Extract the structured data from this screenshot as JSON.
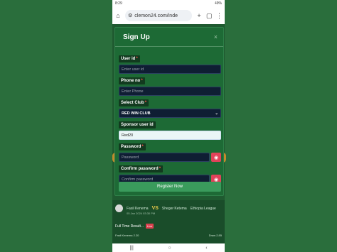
{
  "status_bar": {
    "time": "8:29",
    "battery": "49%"
  },
  "browser": {
    "url": "clemon24.com/inde"
  },
  "modal": {
    "title": "Sign Up",
    "close": "×",
    "fields": [
      {
        "label": "User id",
        "placeholder": "Enter user id",
        "value": ""
      },
      {
        "label": "Phone no",
        "placeholder": "Enter Phone",
        "value": ""
      },
      {
        "label": "Select Club",
        "placeholder": "",
        "value": "RED WIN CLUB"
      },
      {
        "label": "Sponsor user id",
        "placeholder": "",
        "value": "Red20"
      },
      {
        "label": "Password",
        "placeholder": "Password",
        "value": ""
      },
      {
        "label": "Confirm password",
        "placeholder": "Confirm password",
        "value": ""
      }
    ],
    "required_mark": "*",
    "register_label": "Register Now"
  },
  "match": {
    "team_home": "Fasil Kenema",
    "team_away": "Sheger Ketema",
    "league": "Ethiopia League",
    "date": "05 Jan 2024 03:30 PM",
    "result_label": "Full Time Result...",
    "live_badge": "Live",
    "odds": [
      "Fasil Kenema 2.20",
      "Draw 2.85"
    ]
  },
  "colors": {
    "accent": "#3a9b5c",
    "danger": "#e0435a",
    "background": "#2a6e3c"
  }
}
